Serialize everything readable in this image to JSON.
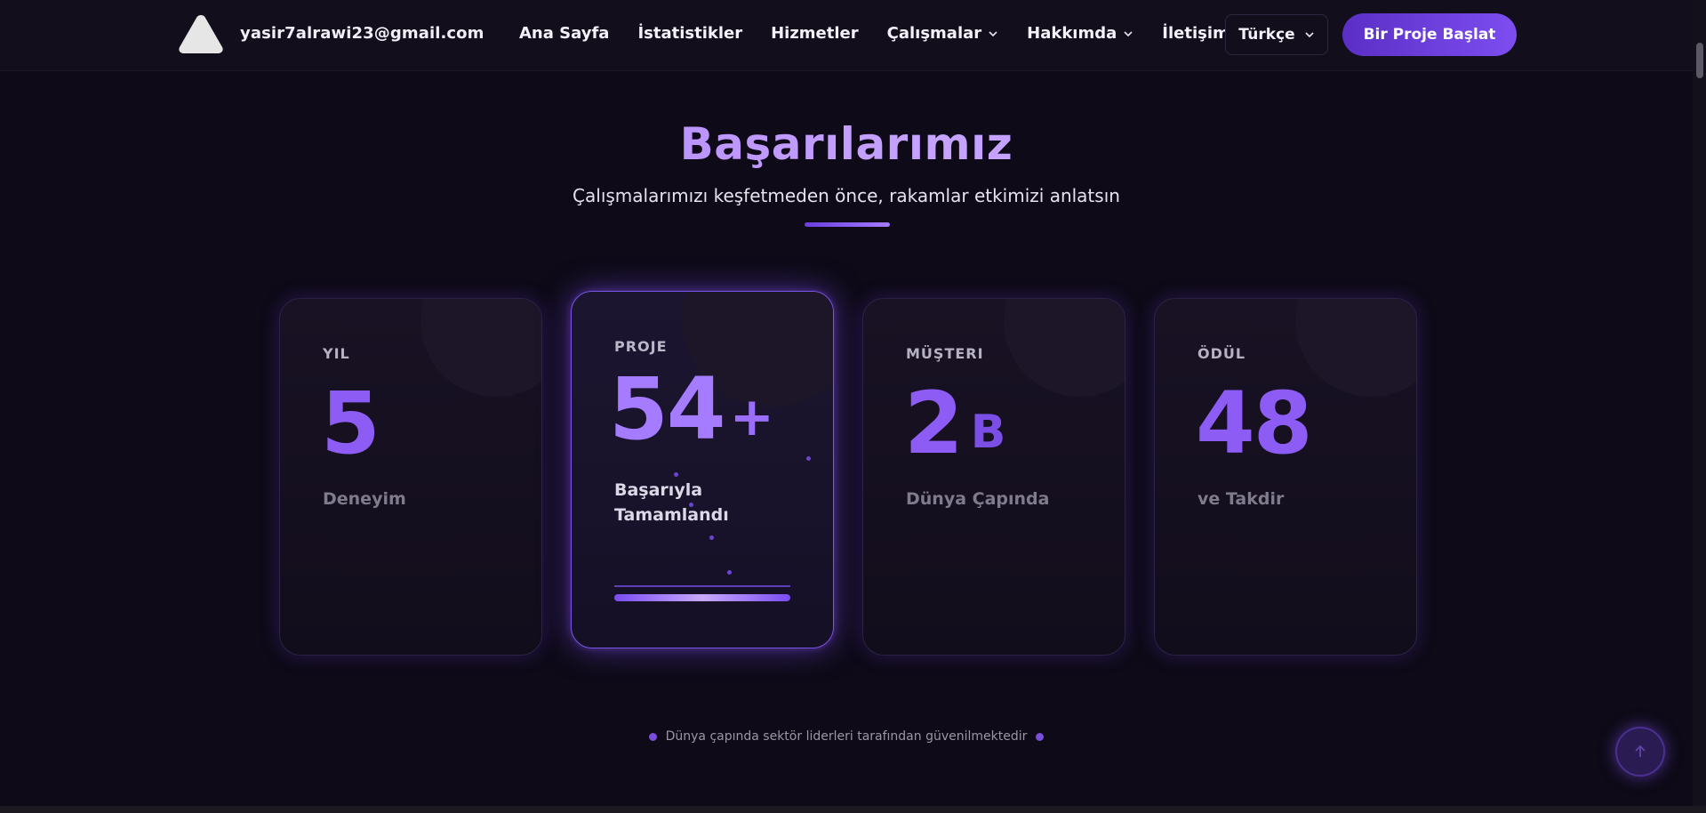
{
  "header": {
    "email": "yasir7alrawi23@gmail.com",
    "nav": [
      {
        "label": "Ana Sayfa",
        "dropdown": false
      },
      {
        "label": "İstatistikler",
        "dropdown": false
      },
      {
        "label": "Hizmetler",
        "dropdown": false
      },
      {
        "label": "Çalışmalar",
        "dropdown": true
      },
      {
        "label": "Hakkımda",
        "dropdown": true
      },
      {
        "label": "İletişim",
        "dropdown": false
      }
    ],
    "language": "Türkçe",
    "cta_label": "Bir Proje Başlat"
  },
  "section": {
    "title": "Başarılarımız",
    "subtitle": "Çalışmalarımızı keşfetmeden önce, rakamlar etkimizi anlatsın"
  },
  "stats": [
    {
      "label": "YIL",
      "value": "5",
      "suffix": "",
      "desc": "Deneyim",
      "active": false
    },
    {
      "label": "PROJE",
      "value": "54",
      "suffix": "+",
      "desc": "Başarıyla Tamamlandı",
      "active": true,
      "progress": 1.0
    },
    {
      "label": "MÜŞTERI",
      "value": "2",
      "suffix": "B",
      "desc": "Dünya Çapında",
      "active": false
    },
    {
      "label": "ÖDÜL",
      "value": "48",
      "suffix": "",
      "desc": "ve Takdir",
      "active": false
    }
  ],
  "trust_note": "Dünya çapında sektör liderleri tarafından güvenilmektedir",
  "colors": {
    "background": "#0e0a17",
    "accent": "#8d5cf5",
    "cta_start": "#5b2fc6",
    "cta_end": "#7d4df0"
  },
  "icons": {
    "logo": "triangle-logo-icon",
    "dropdown": "chevron-down-icon",
    "scroll_top": "arrow-up-icon"
  }
}
